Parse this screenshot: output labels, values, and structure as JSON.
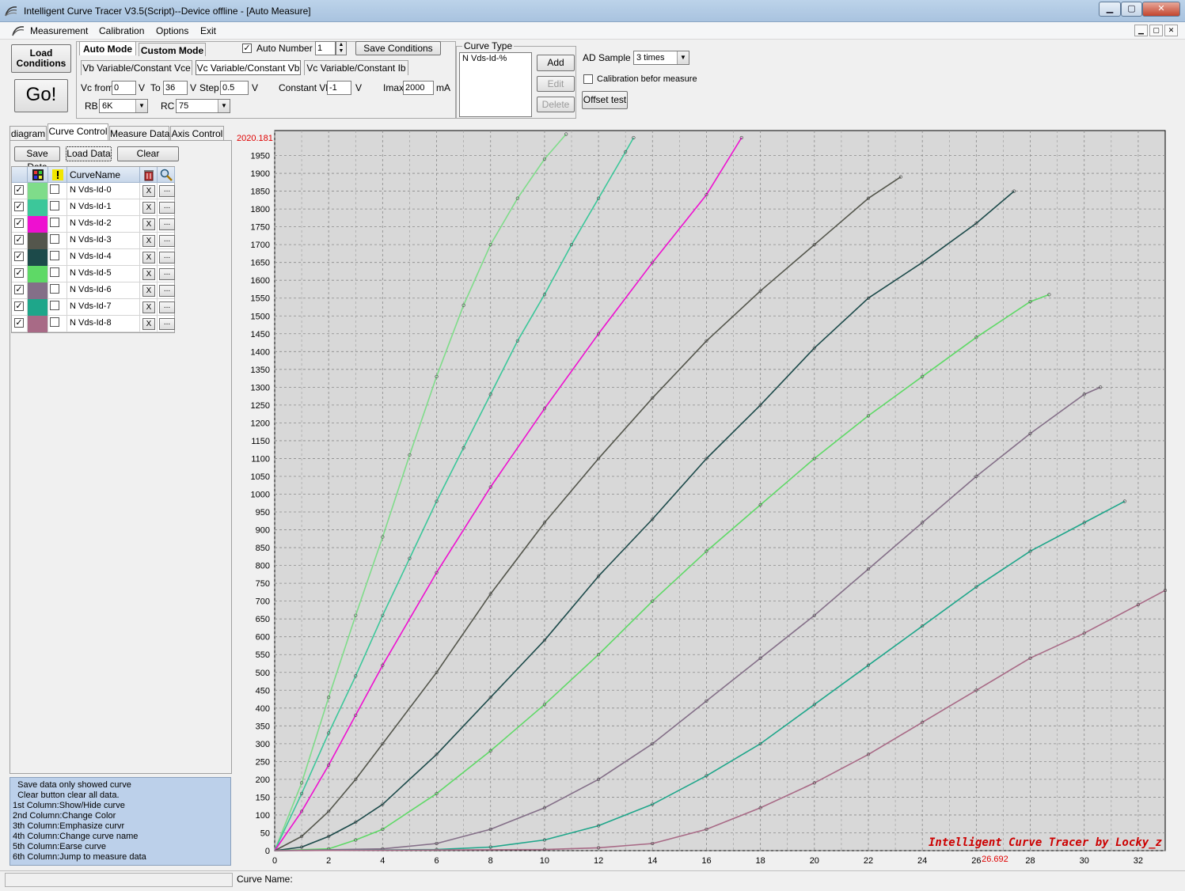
{
  "window": {
    "title": "Intelligent Curve Tracer V3.5(Script)--Device offline - [Auto Measure]",
    "minimize": "▁",
    "maximize": "▢",
    "close": "✕"
  },
  "menu": {
    "items": [
      "Measurement",
      "Calibration",
      "Options",
      "Exit"
    ]
  },
  "toolbar": {
    "load_conditions": "Load Conditions",
    "go": "Go!",
    "auto_mode": "Auto Mode",
    "custom_mode": "Custom Mode",
    "auto_number_label": "Auto Number",
    "auto_number_checked": true,
    "auto_number_value": "1",
    "save_conditions": "Save Conditions",
    "mode_tabs": [
      "Vb Variable/Constant Vce",
      "Vc Variable/Constant Vb",
      "Vc Variable/Constant Ib"
    ],
    "active_mode_tab": 1,
    "vc_from_label": "Vc from",
    "vc_from": "0",
    "v_unit": "V",
    "to_label": "To",
    "to_value": "36",
    "step_label": "Step",
    "step_value": "0.5",
    "constant_vb_label": "Constant Vb",
    "constant_vb": "-1",
    "imax_label": "Imax",
    "imax": "2000",
    "ma_unit": "mA",
    "rb_label": "RB",
    "rb_value": "6K",
    "rc_label": "RC",
    "rc_value": "75",
    "curve_type_label": "Curve Type",
    "curve_type_value": "N Vds-Id-%",
    "add": "Add",
    "edit": "Edit",
    "delete": "Delete",
    "ad_sample_label": "AD Sample",
    "ad_sample_value": "3 times",
    "calibration_label": "Calibration befor measure",
    "offset_test": "Offset test"
  },
  "left_panel": {
    "tabs": [
      "diagram",
      "Curve Control",
      "Measure Data",
      "Axis Control"
    ],
    "active_tab": 1,
    "save_data": "Save Data",
    "load_data": "Load Data",
    "clear": "Clear",
    "grid_header_name": "CurveName",
    "curves": [
      {
        "name": "N Vds-Id-0",
        "color": "#7fdc8a",
        "shown": true
      },
      {
        "name": "N Vds-Id-1",
        "color": "#3cc79a",
        "shown": true
      },
      {
        "name": "N Vds-Id-2",
        "color": "#ee10d0",
        "shown": true
      },
      {
        "name": "N Vds-Id-3",
        "color": "#54564c",
        "shown": true
      },
      {
        "name": "N Vds-Id-4",
        "color": "#1c4a4a",
        "shown": true
      },
      {
        "name": "N Vds-Id-5",
        "color": "#5ed966",
        "shown": true
      },
      {
        "name": "N Vds-Id-6",
        "color": "#846f88",
        "shown": true
      },
      {
        "name": "N Vds-Id-7",
        "color": "#1ea68a",
        "shown": true
      },
      {
        "name": "N Vds-Id-8",
        "color": "#a86a86",
        "shown": true
      }
    ],
    "x_label": "X",
    "dots_label": "...",
    "help_lines": [
      "  Save data only showed curve",
      "  Clear button clear all data.",
      "1st Column:Show/Hide curve",
      "2nd Column:Change Color",
      "3th Column:Emphasize curvr",
      "4th Column:Change curve name",
      "5th Column:Earse curve",
      "6th Column:Jump to measure data"
    ]
  },
  "status": {
    "curve_name_label": "Curve Name:"
  },
  "chart_data": {
    "type": "line",
    "title": "",
    "xlabel": "",
    "ylabel": "",
    "xlim": [
      0,
      33
    ],
    "ylim": [
      0,
      2020
    ],
    "x_ticks": [
      0,
      2,
      4,
      6,
      8,
      10,
      12,
      14,
      16,
      18,
      20,
      22,
      24,
      26,
      28,
      30,
      32
    ],
    "y_ticks": [
      0,
      50,
      100,
      150,
      200,
      250,
      300,
      350,
      400,
      450,
      500,
      550,
      600,
      650,
      700,
      750,
      800,
      850,
      900,
      950,
      1000,
      1050,
      1100,
      1150,
      1200,
      1250,
      1300,
      1350,
      1400,
      1450,
      1500,
      1550,
      1600,
      1650,
      1700,
      1750,
      1800,
      1850,
      1900,
      1950
    ],
    "y_max_label": "2020.181",
    "cursor_x_label": "26.692",
    "watermark": "Intelligent Curve Tracer by Locky_z",
    "grid": true,
    "series": [
      {
        "name": "N Vds-Id-0",
        "color": "#7fdc8a",
        "points": [
          [
            0,
            0
          ],
          [
            1,
            190
          ],
          [
            2,
            430
          ],
          [
            3,
            660
          ],
          [
            4,
            880
          ],
          [
            5,
            1110
          ],
          [
            6,
            1330
          ],
          [
            7,
            1530
          ],
          [
            8,
            1700
          ],
          [
            9,
            1830
          ],
          [
            10,
            1940
          ],
          [
            10.8,
            2010
          ]
        ]
      },
      {
        "name": "N Vds-Id-1",
        "color": "#3cc79a",
        "points": [
          [
            0,
            0
          ],
          [
            1,
            160
          ],
          [
            2,
            330
          ],
          [
            3,
            490
          ],
          [
            4,
            660
          ],
          [
            5,
            820
          ],
          [
            6,
            980
          ],
          [
            7,
            1130
          ],
          [
            8,
            1280
          ],
          [
            9,
            1430
          ],
          [
            10,
            1560
          ],
          [
            11,
            1700
          ],
          [
            12,
            1830
          ],
          [
            13,
            1960
          ],
          [
            13.3,
            2000
          ]
        ]
      },
      {
        "name": "N Vds-Id-2",
        "color": "#ee10d0",
        "points": [
          [
            0,
            0
          ],
          [
            1,
            110
          ],
          [
            2,
            240
          ],
          [
            3,
            380
          ],
          [
            4,
            520
          ],
          [
            6,
            780
          ],
          [
            8,
            1020
          ],
          [
            10,
            1240
          ],
          [
            12,
            1450
          ],
          [
            14,
            1650
          ],
          [
            16,
            1840
          ],
          [
            17.3,
            2000
          ]
        ]
      },
      {
        "name": "N Vds-Id-3",
        "color": "#54564c",
        "points": [
          [
            0,
            0
          ],
          [
            1,
            40
          ],
          [
            2,
            110
          ],
          [
            3,
            200
          ],
          [
            4,
            300
          ],
          [
            6,
            500
          ],
          [
            8,
            720
          ],
          [
            10,
            920
          ],
          [
            12,
            1100
          ],
          [
            14,
            1270
          ],
          [
            16,
            1430
          ],
          [
            18,
            1570
          ],
          [
            20,
            1700
          ],
          [
            22,
            1830
          ],
          [
            23.2,
            1890
          ]
        ]
      },
      {
        "name": "N Vds-Id-4",
        "color": "#1c4a4a",
        "points": [
          [
            0,
            0
          ],
          [
            1,
            10
          ],
          [
            2,
            40
          ],
          [
            3,
            80
          ],
          [
            4,
            130
          ],
          [
            6,
            270
          ],
          [
            8,
            430
          ],
          [
            10,
            590
          ],
          [
            12,
            770
          ],
          [
            14,
            930
          ],
          [
            16,
            1100
          ],
          [
            18,
            1250
          ],
          [
            20,
            1410
          ],
          [
            22,
            1550
          ],
          [
            24,
            1650
          ],
          [
            26,
            1760
          ],
          [
            27.4,
            1850
          ]
        ]
      },
      {
        "name": "N Vds-Id-5",
        "color": "#5ed966",
        "points": [
          [
            0,
            0
          ],
          [
            2,
            5
          ],
          [
            3,
            30
          ],
          [
            4,
            60
          ],
          [
            6,
            160
          ],
          [
            8,
            280
          ],
          [
            10,
            410
          ],
          [
            12,
            550
          ],
          [
            14,
            700
          ],
          [
            16,
            840
          ],
          [
            18,
            970
          ],
          [
            20,
            1100
          ],
          [
            22,
            1220
          ],
          [
            24,
            1330
          ],
          [
            26,
            1440
          ],
          [
            28,
            1540
          ],
          [
            28.7,
            1560
          ]
        ]
      },
      {
        "name": "N Vds-Id-6",
        "color": "#846f88",
        "points": [
          [
            0,
            0
          ],
          [
            4,
            5
          ],
          [
            6,
            20
          ],
          [
            8,
            60
          ],
          [
            10,
            120
          ],
          [
            12,
            200
          ],
          [
            14,
            300
          ],
          [
            16,
            420
          ],
          [
            18,
            540
          ],
          [
            20,
            660
          ],
          [
            22,
            790
          ],
          [
            24,
            920
          ],
          [
            26,
            1050
          ],
          [
            28,
            1170
          ],
          [
            30,
            1280
          ],
          [
            30.6,
            1300
          ]
        ]
      },
      {
        "name": "N Vds-Id-7",
        "color": "#1ea68a",
        "points": [
          [
            0,
            0
          ],
          [
            6,
            3
          ],
          [
            8,
            10
          ],
          [
            10,
            30
          ],
          [
            12,
            70
          ],
          [
            14,
            130
          ],
          [
            16,
            210
          ],
          [
            18,
            300
          ],
          [
            20,
            410
          ],
          [
            22,
            520
          ],
          [
            24,
            630
          ],
          [
            26,
            740
          ],
          [
            28,
            840
          ],
          [
            30,
            920
          ],
          [
            31.5,
            980
          ]
        ]
      },
      {
        "name": "N Vds-Id-8",
        "color": "#a86a86",
        "points": [
          [
            0,
            0
          ],
          [
            10,
            3
          ],
          [
            12,
            8
          ],
          [
            14,
            20
          ],
          [
            16,
            60
          ],
          [
            18,
            120
          ],
          [
            20,
            190
          ],
          [
            22,
            270
          ],
          [
            24,
            360
          ],
          [
            26,
            450
          ],
          [
            28,
            540
          ],
          [
            30,
            610
          ],
          [
            32,
            690
          ],
          [
            33,
            730
          ]
        ]
      }
    ]
  }
}
